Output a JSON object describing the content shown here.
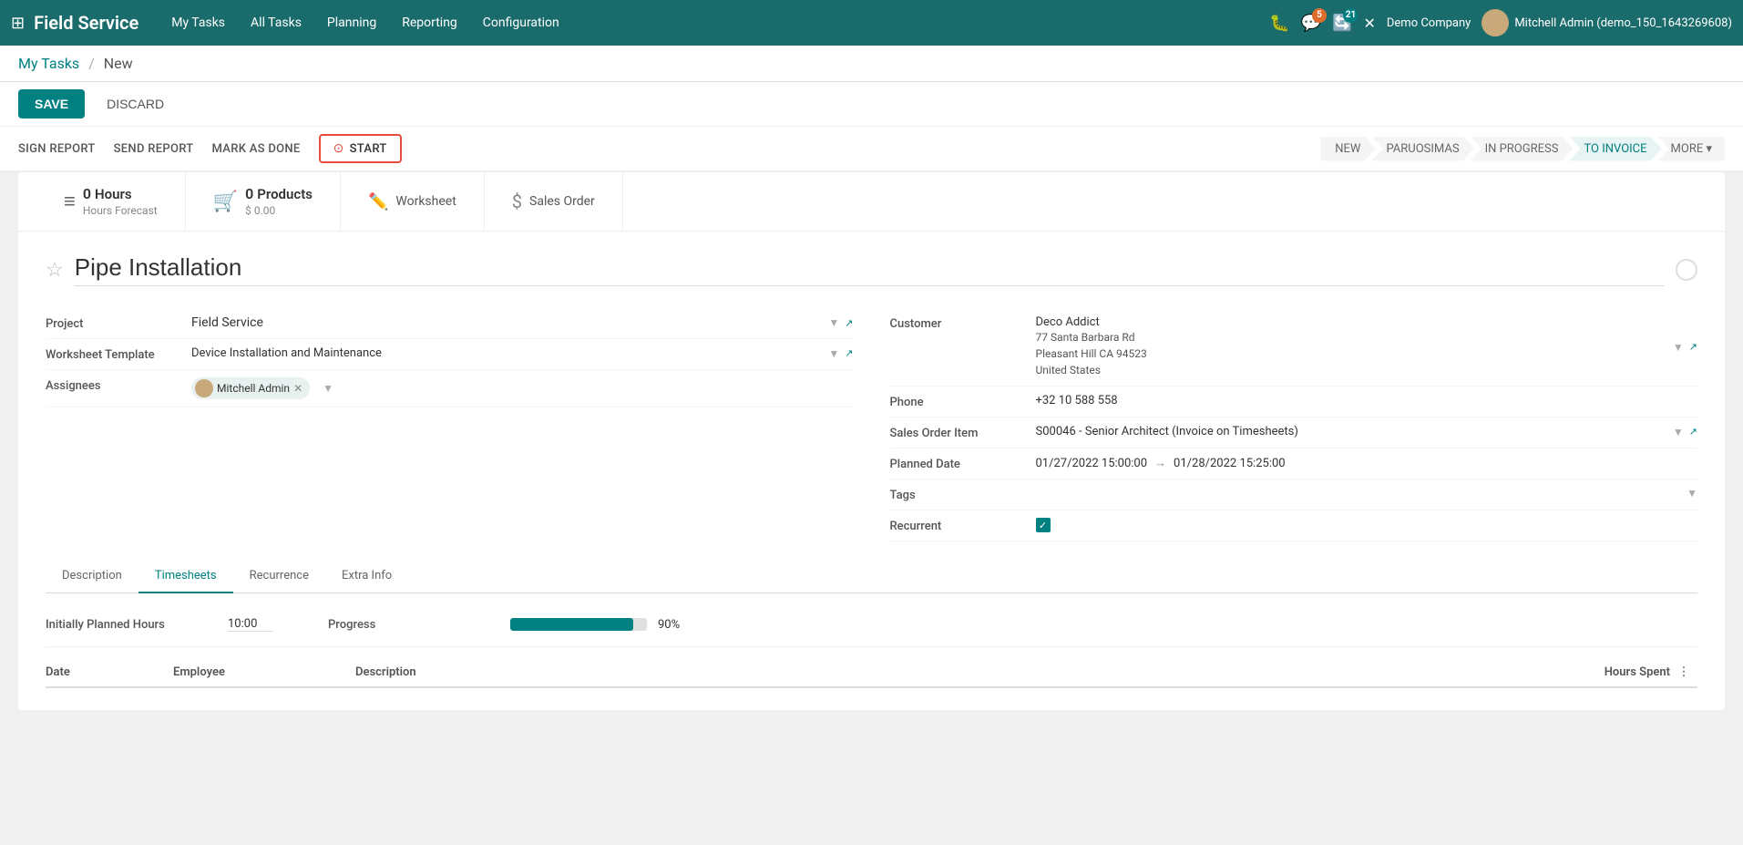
{
  "app": {
    "name": "Field Service",
    "grid_icon": "⊞"
  },
  "topnav": {
    "menu_items": [
      "My Tasks",
      "All Tasks",
      "Planning",
      "Reporting",
      "Configuration"
    ],
    "icons": {
      "bug": "🐛",
      "chat": "💬",
      "chat_badge": "5",
      "refresh": "🔄",
      "refresh_badge": "21",
      "close": "✕"
    },
    "company": "Demo Company",
    "user": "Mitchell Admin (demo_150_1643269608)"
  },
  "breadcrumb": {
    "parent": "My Tasks",
    "separator": "/",
    "current": "New"
  },
  "action_bar": {
    "save": "SAVE",
    "discard": "DISCARD"
  },
  "status_bar": {
    "actions": [
      "SIGN REPORT",
      "SEND REPORT",
      "MARK AS DONE"
    ],
    "start_label": "START",
    "pipeline": [
      "NEW",
      "PARUOSIMAS",
      "IN PROGRESS",
      "TO INVOICE",
      "MORE ▾"
    ]
  },
  "smart_buttons": [
    {
      "icon": "≡",
      "num": "0",
      "label": "Hours Forecast"
    },
    {
      "icon": "🛒",
      "num": "0",
      "label": "Products $ 0.00"
    },
    {
      "icon": "✏️",
      "label": "Worksheet"
    },
    {
      "icon": "$",
      "label": "Sales Order"
    }
  ],
  "form": {
    "title": "Pipe Installation",
    "fields_left": {
      "project_label": "Project",
      "project_value": "Field Service",
      "worksheet_label": "Worksheet Template",
      "worksheet_value": "Device Installation and Maintenance",
      "assignees_label": "Assignees",
      "assignee_name": "Mitchell Admin"
    },
    "fields_right": {
      "customer_label": "Customer",
      "customer_value": "Deco Addict",
      "customer_address": "77 Santa Barbara Rd\nPleasant Hill CA 94523\nUnited States",
      "phone_label": "Phone",
      "phone_value": "+32 10 588 558",
      "sales_order_label": "Sales Order Item",
      "sales_order_value": "S00046 - Senior Architect (Invoice on Timesheets)",
      "planned_date_label": "Planned Date",
      "planned_date_start": "01/27/2022 15:00:00",
      "planned_date_end": "01/28/2022 15:25:00",
      "tags_label": "Tags",
      "recurrent_label": "Recurrent"
    },
    "tabs": [
      "Description",
      "Timesheets",
      "Recurrence",
      "Extra Info"
    ],
    "active_tab": "Timesheets",
    "timesheets": {
      "initially_planned_label": "Initially Planned Hours",
      "initially_planned_value": "10:00",
      "progress_label": "Progress",
      "progress_pct": 90,
      "progress_pct_label": "90%",
      "table_headers": {
        "date": "Date",
        "employee": "Employee",
        "description": "Description",
        "hours_spent": "Hours Spent"
      }
    }
  }
}
